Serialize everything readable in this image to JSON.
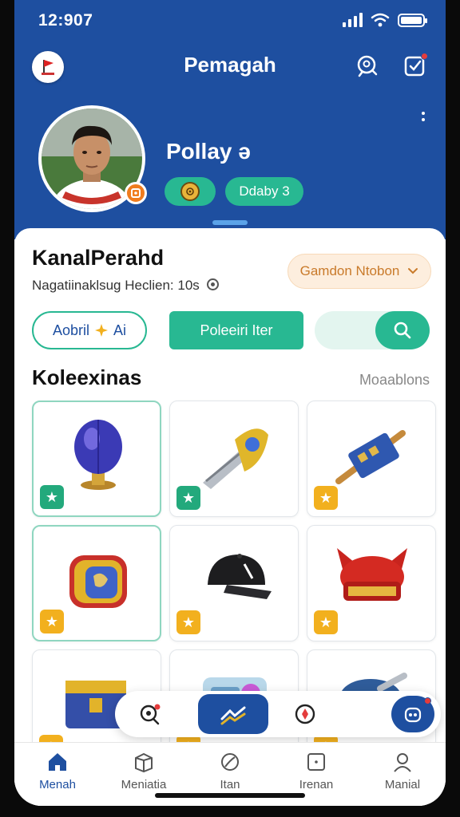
{
  "status_bar": {
    "time": "12:907"
  },
  "header": {
    "title": "Pemagah",
    "logo_text": "flag",
    "icons": [
      "chat-search-icon",
      "checkbox-icon"
    ]
  },
  "profile": {
    "name": "Pollay ə",
    "level_label": "Ddaby 3"
  },
  "section": {
    "title": "KanalPerahd",
    "subtitle": "Nagatiinaklsug Heclien: 10s",
    "dropdown_label": "Gamdon Ntobon"
  },
  "actions": {
    "outline_label": "Aobril",
    "outline_suffix": "Ai",
    "solid_label": "Poleeiri Iter"
  },
  "collection": {
    "title": "Koleexinas",
    "link_label": "Moaablons",
    "items": [
      {
        "icon": "crystal-orb-icon",
        "rarity": "green"
      },
      {
        "icon": "gold-cannon-icon",
        "rarity": "green"
      },
      {
        "icon": "blue-scroll-icon",
        "rarity": "gold"
      },
      {
        "icon": "trophy-shield-icon",
        "rarity": "gold"
      },
      {
        "icon": "black-cap-icon",
        "rarity": "gold"
      },
      {
        "icon": "red-helmet-icon",
        "rarity": "gold"
      },
      {
        "icon": "treasure-chest-icon",
        "rarity": "gold"
      },
      {
        "icon": "device-icon",
        "rarity": "gold"
      },
      {
        "icon": "blue-hat-icon",
        "rarity": "gold"
      }
    ]
  },
  "bottom_nav": {
    "items": [
      {
        "label": "Menah",
        "icon": "home-icon",
        "active": true
      },
      {
        "label": "Meniatia",
        "icon": "box-icon",
        "active": false
      },
      {
        "label": "Itan",
        "icon": "leaf-icon",
        "active": false
      },
      {
        "label": "Irenan",
        "icon": "square-icon",
        "active": false
      },
      {
        "label": "Manial",
        "icon": "user-icon",
        "active": false
      }
    ]
  },
  "colors": {
    "brand_blue": "#1e4fa0",
    "accent_green": "#28b892",
    "orange": "#c97a2a"
  }
}
